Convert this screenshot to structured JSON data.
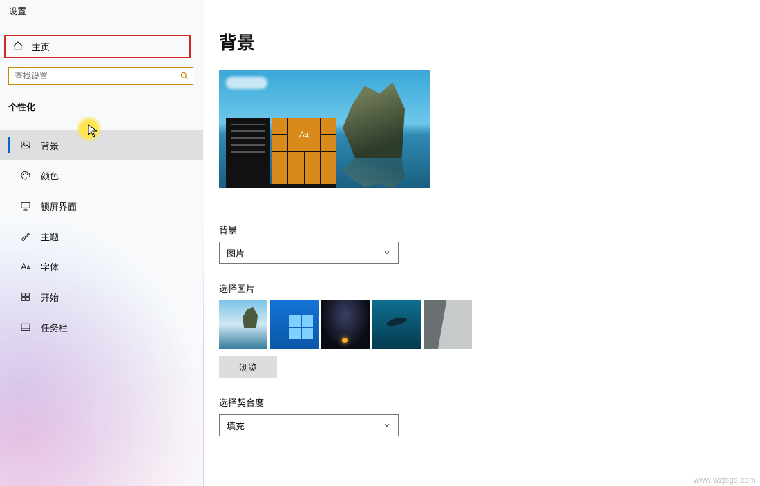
{
  "sidebar": {
    "title": "设置",
    "home_label": "主页",
    "search_placeholder": "查找设置",
    "section_label": "个性化",
    "items": [
      {
        "label": "背景"
      },
      {
        "label": "颜色"
      },
      {
        "label": "锁屏界面"
      },
      {
        "label": "主题"
      },
      {
        "label": "字体"
      },
      {
        "label": "开始"
      },
      {
        "label": "任务栏"
      }
    ]
  },
  "main": {
    "page_title": "背景",
    "preview_tile_text": "Aa",
    "background_label": "背景",
    "background_select_value": "图片",
    "choose_picture_label": "选择图片",
    "browse_label": "浏览",
    "fit_label": "选择契合度",
    "fit_select_value": "填充"
  },
  "watermark": "www.wzjsgs.com"
}
